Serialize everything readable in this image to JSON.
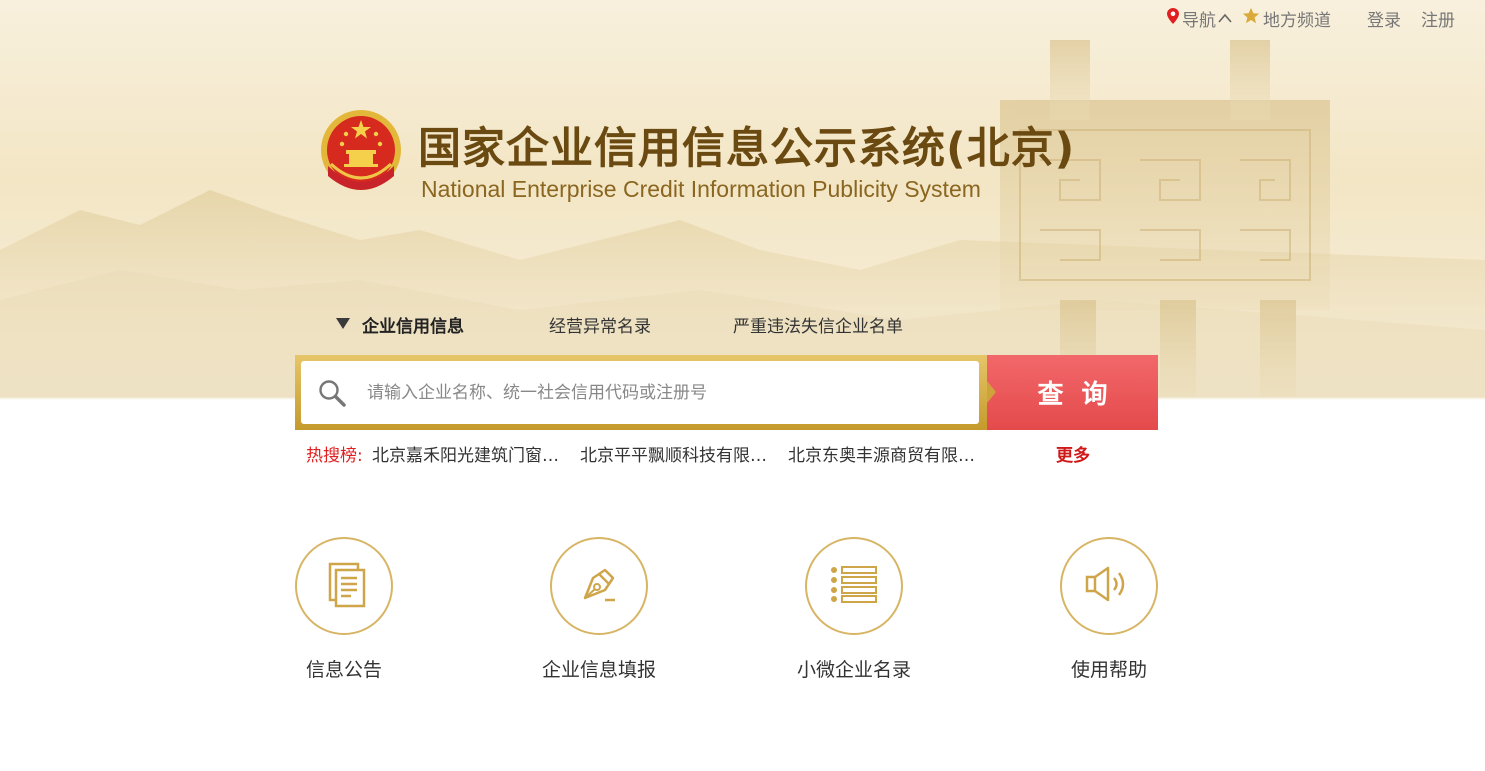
{
  "topbar": {
    "nav_label": "导航",
    "local_channel_label": "地方频道",
    "login_label": "登录",
    "register_label": "注册"
  },
  "header": {
    "title_cn": "国家企业信用信息公示系统(北京)",
    "title_en": "National Enterprise Credit Information Publicity System"
  },
  "tabs": [
    {
      "label": "企业信用信息",
      "active": true
    },
    {
      "label": "经营异常名录",
      "active": false
    },
    {
      "label": "严重违法失信企业名单",
      "active": false
    }
  ],
  "search": {
    "placeholder": "请输入企业名称、统一社会信用代码或注册号",
    "button_label": "查询"
  },
  "hot_search": {
    "label": "热搜榜:",
    "items": [
      "北京嘉禾阳光建筑门窗…",
      "北京平平飘顺科技有限…",
      "北京东奥丰源商贸有限…"
    ],
    "more_label": "更多"
  },
  "features": [
    {
      "label": "信息公告",
      "icon": "document-icon"
    },
    {
      "label": "企业信息填报",
      "icon": "pen-icon"
    },
    {
      "label": "小微企业名录",
      "icon": "list-icon"
    },
    {
      "label": "使用帮助",
      "icon": "speaker-icon"
    }
  ],
  "colors": {
    "gold": "#d7b565",
    "brown_title": "#6b4a12",
    "search_red": "#e44a4c",
    "hot_red": "#e02020"
  }
}
